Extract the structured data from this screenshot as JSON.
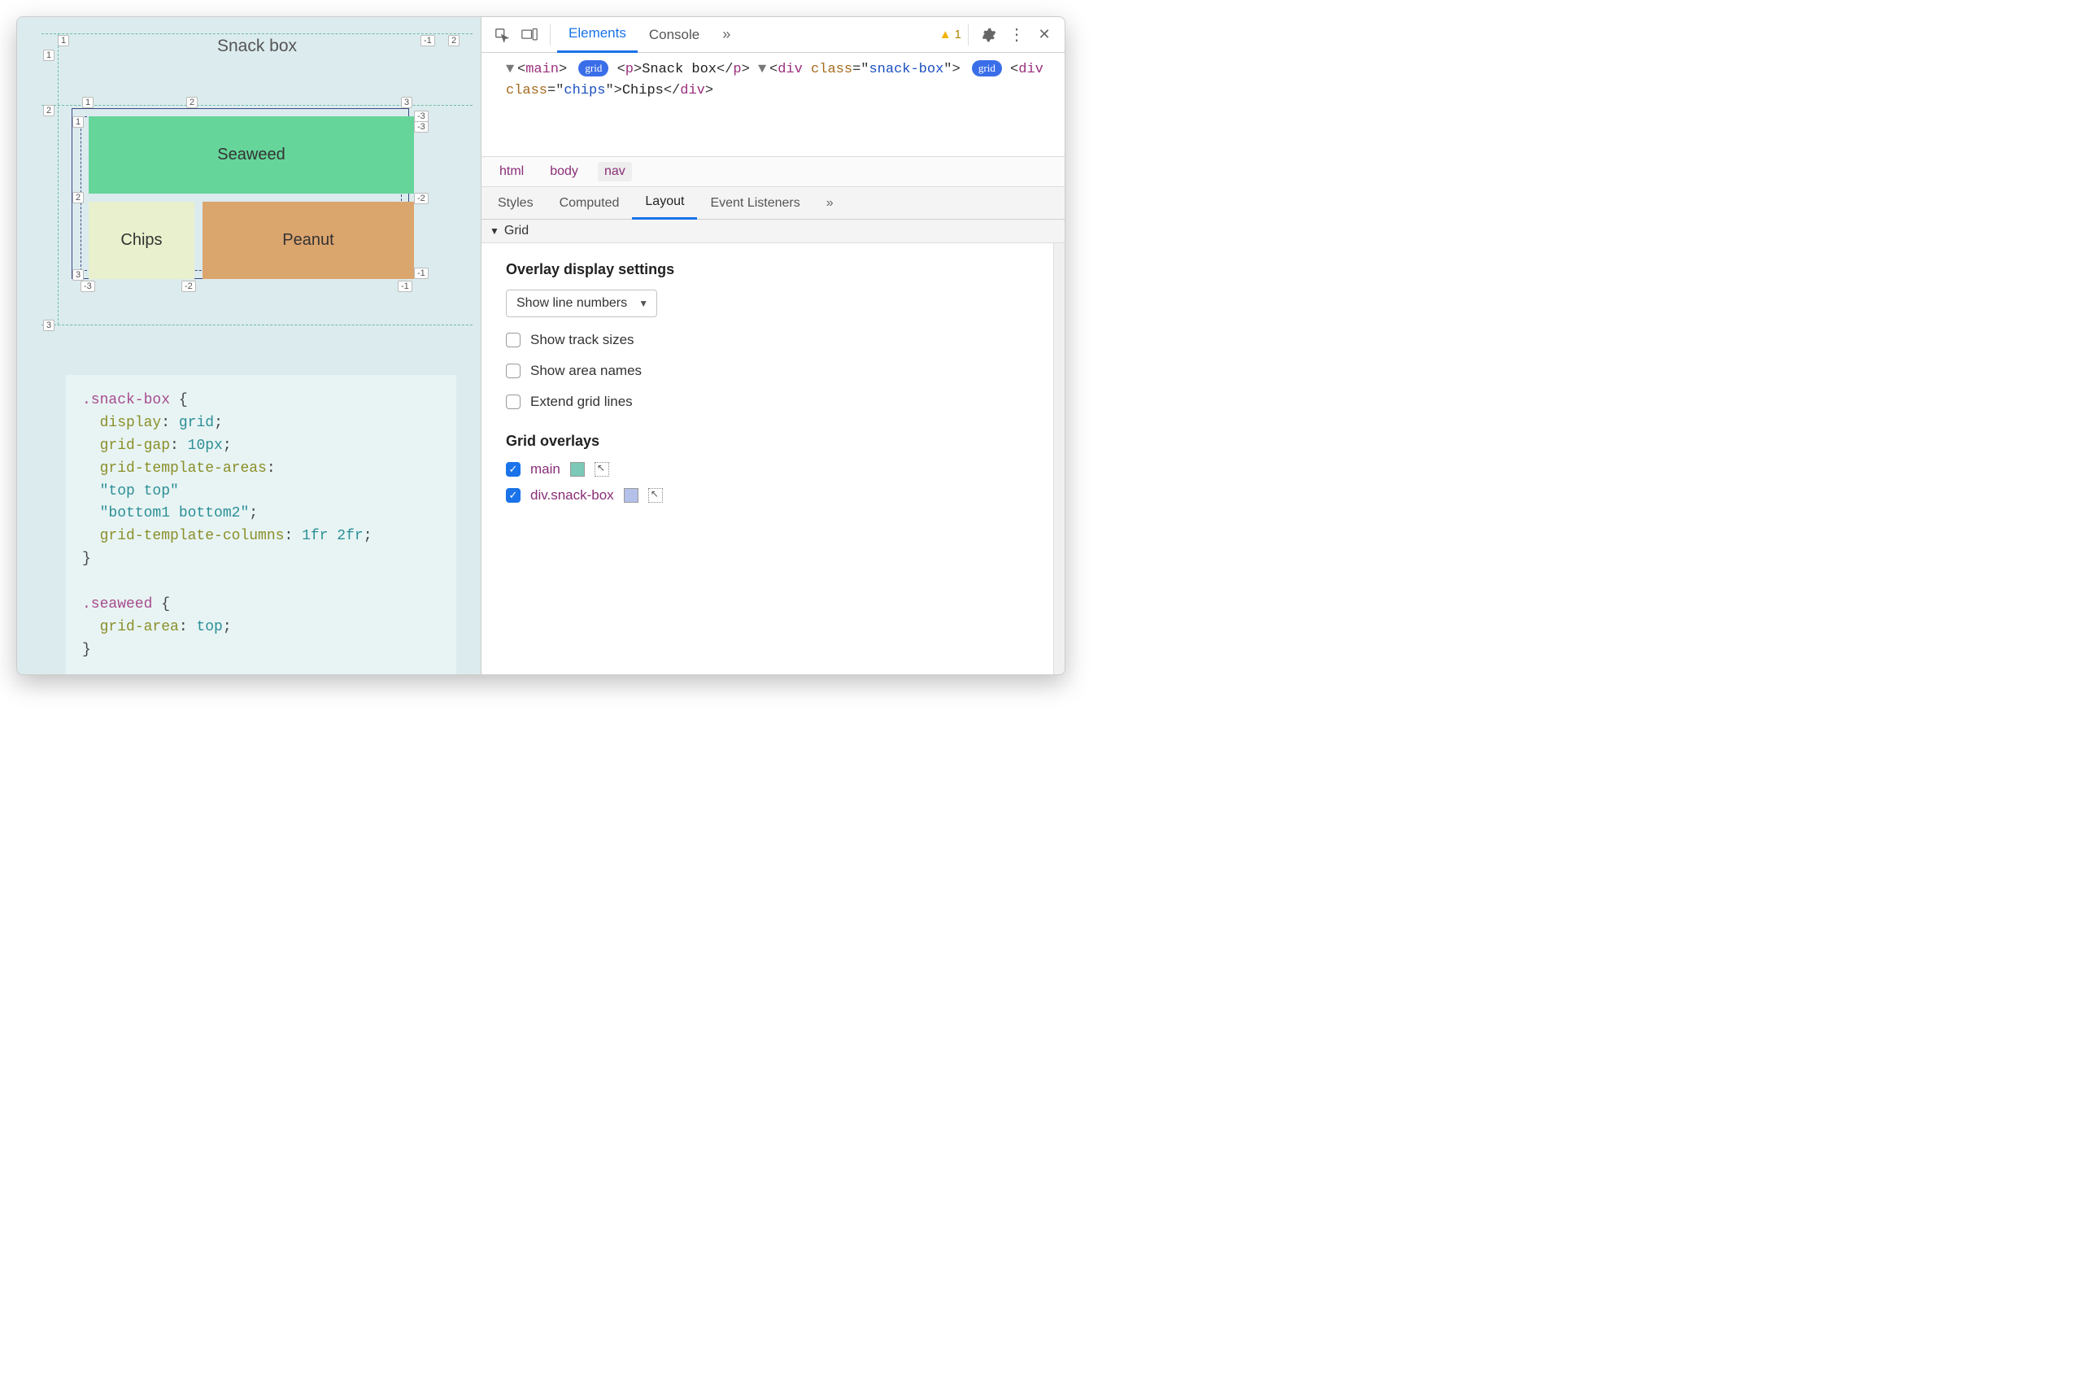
{
  "page": {
    "title": "Snack box",
    "cells": {
      "seaweed": "Seaweed",
      "chips": "Chips",
      "peanut": "Peanut"
    },
    "line_numbers_outer": {
      "top": [
        "1",
        "-1",
        "2"
      ],
      "left": [
        "1",
        "2",
        "3"
      ]
    },
    "line_numbers_inner": {
      "top": [
        "1",
        "2",
        "3"
      ],
      "top_neg": "-3",
      "left": [
        "1",
        "2",
        "3"
      ],
      "right": [
        "-3",
        "-2",
        "-1"
      ],
      "bottom": [
        "-3",
        "-2",
        "-1"
      ]
    },
    "code": {
      "l1": ".snack-box",
      "l1b": " {",
      "p1": "display",
      "v1": "grid",
      "p2": "grid-gap",
      "v2": "10px",
      "p3": "grid-template-areas",
      "v3a": "\"top top\"",
      "v3b": "\"bottom1 bottom2\"",
      "p4": "grid-template-columns",
      "v4": "1fr 2fr",
      "close": "}",
      "l2": ".seaweed",
      "l2b": " {",
      "p5": "grid-area",
      "v5": "top"
    }
  },
  "devtools": {
    "tabs": {
      "elements": "Elements",
      "console": "Console"
    },
    "warning_count": "1",
    "dom": {
      "main_open": "main",
      "grid_badge": "grid",
      "p_tag": "p",
      "p_text": "Snack box",
      "div_tag": "div",
      "div_class_attr": "class",
      "div_class_val": "snack-box",
      "chips_tag": "div",
      "chips_class_attr": "class",
      "chips_class_val": "chips",
      "chips_text": "Chips"
    },
    "breadcrumbs": [
      "html",
      "body",
      "nav"
    ],
    "subtabs": [
      "Styles",
      "Computed",
      "Layout",
      "Event Listeners"
    ],
    "section": "Grid",
    "overlay_settings": {
      "heading": "Overlay display settings",
      "select": "Show line numbers",
      "cb1": "Show track sizes",
      "cb2": "Show area names",
      "cb3": "Extend grid lines"
    },
    "grid_overlays": {
      "heading": "Grid overlays",
      "items": [
        {
          "name": "main",
          "checked": true
        },
        {
          "name": "div.snack-box",
          "checked": true
        }
      ]
    }
  }
}
